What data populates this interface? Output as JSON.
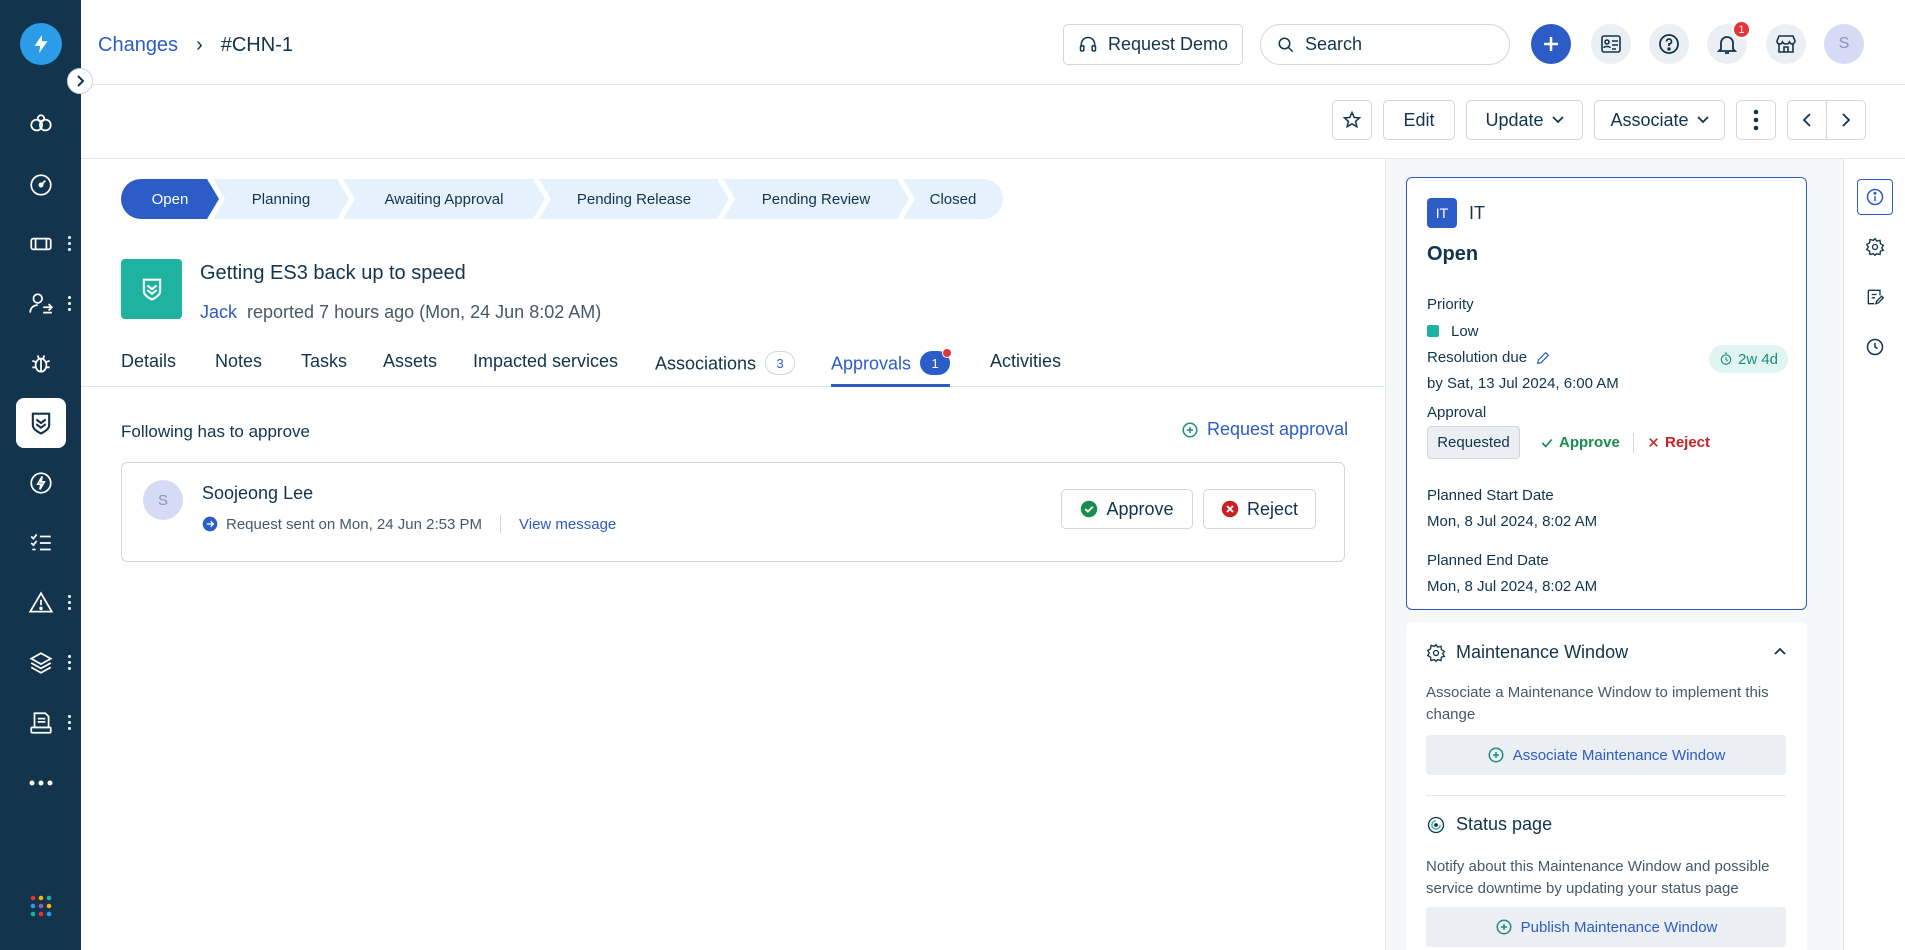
{
  "breadcrumb": {
    "parent": "Changes",
    "separator": "›",
    "current": "#CHN-1"
  },
  "header": {
    "request_demo": "Request Demo",
    "search_placeholder": "Search",
    "notification_count": "1",
    "avatar_initial": "S"
  },
  "toolbar": {
    "edit": "Edit",
    "update": "Update",
    "associate": "Associate"
  },
  "stages": [
    "Open",
    "Planning",
    "Awaiting Approval",
    "Pending Release",
    "Pending Review",
    "Closed"
  ],
  "ticket": {
    "title": "Getting ES3 back up to speed",
    "reporter": "Jack",
    "reported_text": "reported 7 hours ago (Mon, 24 Jun 8:02 AM)"
  },
  "tabs": {
    "details": "Details",
    "notes": "Notes",
    "tasks": "Tasks",
    "assets": "Assets",
    "impacted": "Impacted services",
    "associations": "Associations",
    "associations_count": "3",
    "approvals": "Approvals",
    "approvals_count": "1",
    "activities": "Activities"
  },
  "approvals": {
    "heading": "Following has to approve",
    "request_link": "Request approval",
    "approver_initial": "S",
    "approver_name": "Soojeong Lee",
    "request_sent": "Request sent on Mon, 24 Jun 2:53 PM",
    "view_message": "View message",
    "approve": "Approve",
    "reject": "Reject"
  },
  "info": {
    "workspace_badge": "IT",
    "workspace": "IT",
    "status": "Open",
    "priority_label": "Priority",
    "priority": "Low",
    "resolution_label": "Resolution due",
    "resolution_value": "by Sat, 13 Jul 2024, 6:00 AM",
    "due_chip": "2w 4d",
    "approval_label": "Approval",
    "approval_status": "Requested",
    "approve": "Approve",
    "reject": "Reject",
    "start_label": "Planned Start Date",
    "start_value": "Mon, 8 Jul 2024, 8:02 AM",
    "end_label": "Planned End Date",
    "end_value": "Mon, 8 Jul 2024, 8:02 AM"
  },
  "maintenance": {
    "title": "Maintenance Window",
    "desc": "Associate a Maintenance Window to implement this change",
    "button": "Associate Maintenance Window",
    "status_title": "Status page",
    "status_desc": "Notify about this Maintenance Window and possible service downtime by updating your status page",
    "publish_button": "Publish Maintenance Window"
  },
  "colors": {
    "sidebar": "#12344d",
    "primary": "#2c5cc5",
    "teal": "#1eb2a0",
    "danger": "#e43538"
  }
}
